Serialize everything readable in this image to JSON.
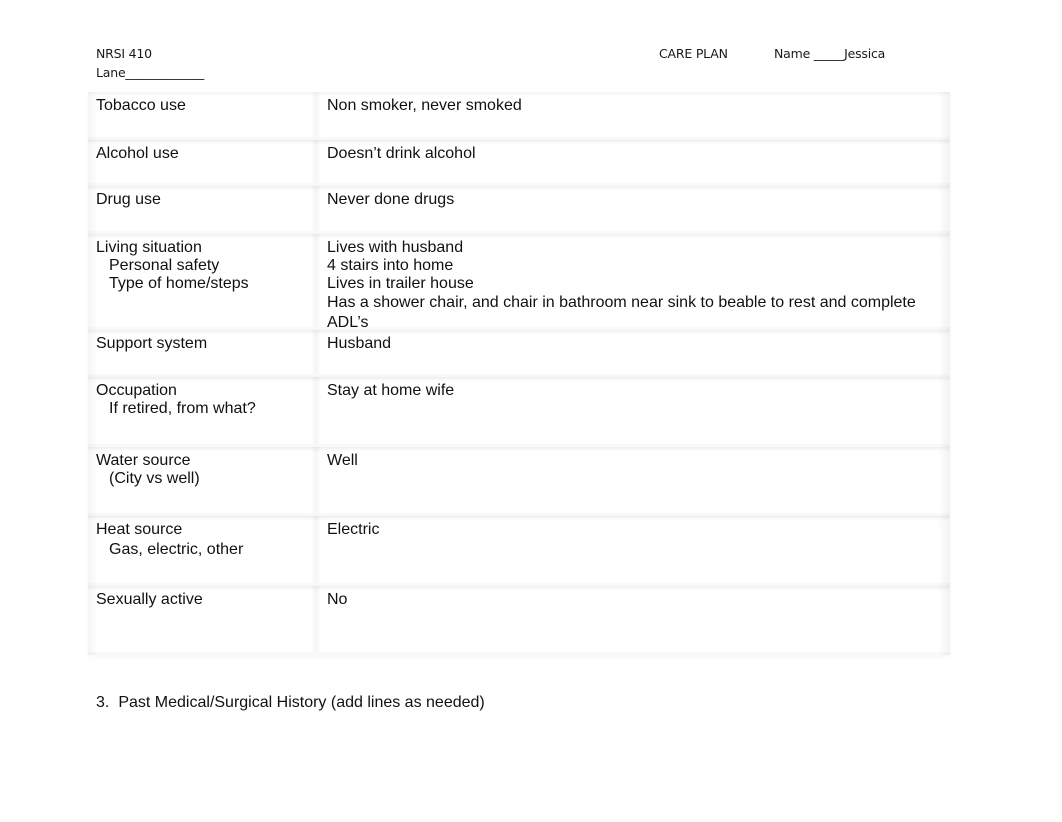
{
  "header": {
    "course": "NRSI 410",
    "lane": "Lane_____________",
    "title": "CARE PLAN",
    "name": "Name _____Jessica"
  },
  "table": {
    "rows": [
      {
        "label": "Tobacco use",
        "sublabels": [],
        "values": [
          "Non smoker, never smoked"
        ]
      },
      {
        "label": "Alcohol use",
        "sublabels": [],
        "values": [
          "Doesn’t drink alcohol"
        ]
      },
      {
        "label": "Drug use",
        "sublabels": [],
        "values": [
          "Never done drugs"
        ]
      },
      {
        "label": "Living situation",
        "sublabels": [
          "Personal safety",
          "Type of home/steps"
        ],
        "values": [
          "Lives with husband",
          "4 stairs into home",
          "Lives in trailer house",
          "Has a shower chair, and chair in bathroom near sink to beable to rest and complete ADL’s"
        ]
      },
      {
        "label": "Support system",
        "sublabels": [],
        "values": [
          "Husband"
        ]
      },
      {
        "label": "Occupation",
        "sublabels": [
          "If retired, from what?"
        ],
        "values": [
          "Stay at home wife"
        ]
      },
      {
        "label": "Water source",
        "sublabels": [
          "(City vs well)"
        ],
        "values": [
          "Well"
        ]
      },
      {
        "label": "Heat source",
        "sublabels": [
          "Gas, electric, other"
        ],
        "values": [
          "Electric"
        ]
      },
      {
        "label": "Sexually active",
        "sublabels": [],
        "values": [
          "No"
        ]
      }
    ]
  },
  "section": {
    "number": "3.",
    "title": "Past Medical/Surgical History (add lines as needed)"
  }
}
